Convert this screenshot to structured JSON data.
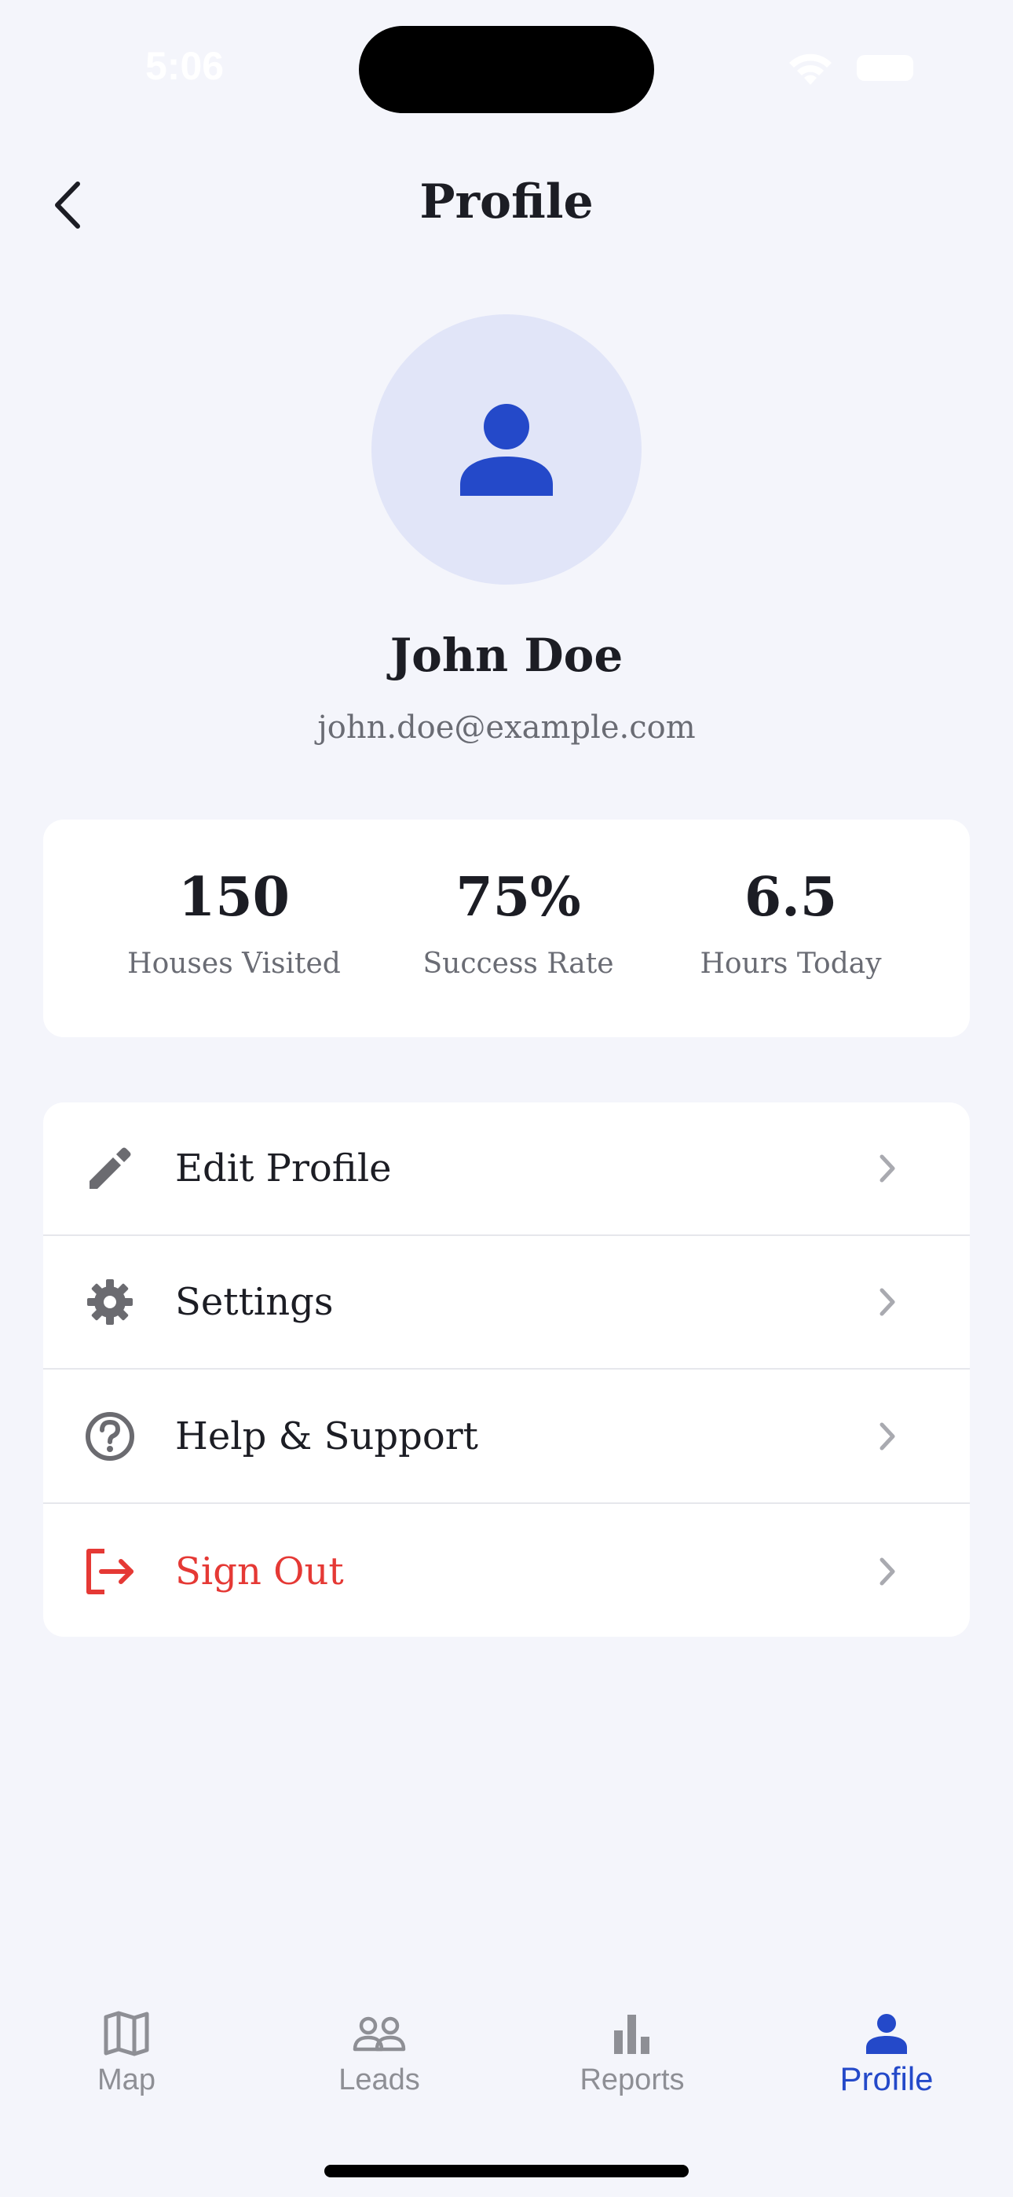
{
  "status_bar": {
    "time": "5:06"
  },
  "header": {
    "title": "Profile"
  },
  "profile": {
    "name": "John Doe",
    "email": "john.doe@example.com"
  },
  "stats": [
    {
      "value": "150",
      "label": "Houses Visited"
    },
    {
      "value": "75%",
      "label": "Success Rate"
    },
    {
      "value": "6.5",
      "label": "Hours Today"
    }
  ],
  "menu": [
    {
      "label": "Edit Profile",
      "icon": "pencil-icon"
    },
    {
      "label": "Settings",
      "icon": "gear-icon"
    },
    {
      "label": "Help & Support",
      "icon": "help-circle-icon"
    },
    {
      "label": "Sign Out",
      "icon": "sign-out-icon"
    }
  ],
  "tabs": [
    {
      "label": "Map",
      "icon": "map-icon",
      "active": false
    },
    {
      "label": "Leads",
      "icon": "people-icon",
      "active": false
    },
    {
      "label": "Reports",
      "icon": "bar-chart-icon",
      "active": false
    },
    {
      "label": "Profile",
      "icon": "person-icon",
      "active": true
    }
  ],
  "colors": {
    "background": "#f4f5fb",
    "accent": "#2449c9",
    "danger": "#e53935",
    "avatar_bg": "#e1e5f8",
    "inactive": "#8e8f95"
  }
}
